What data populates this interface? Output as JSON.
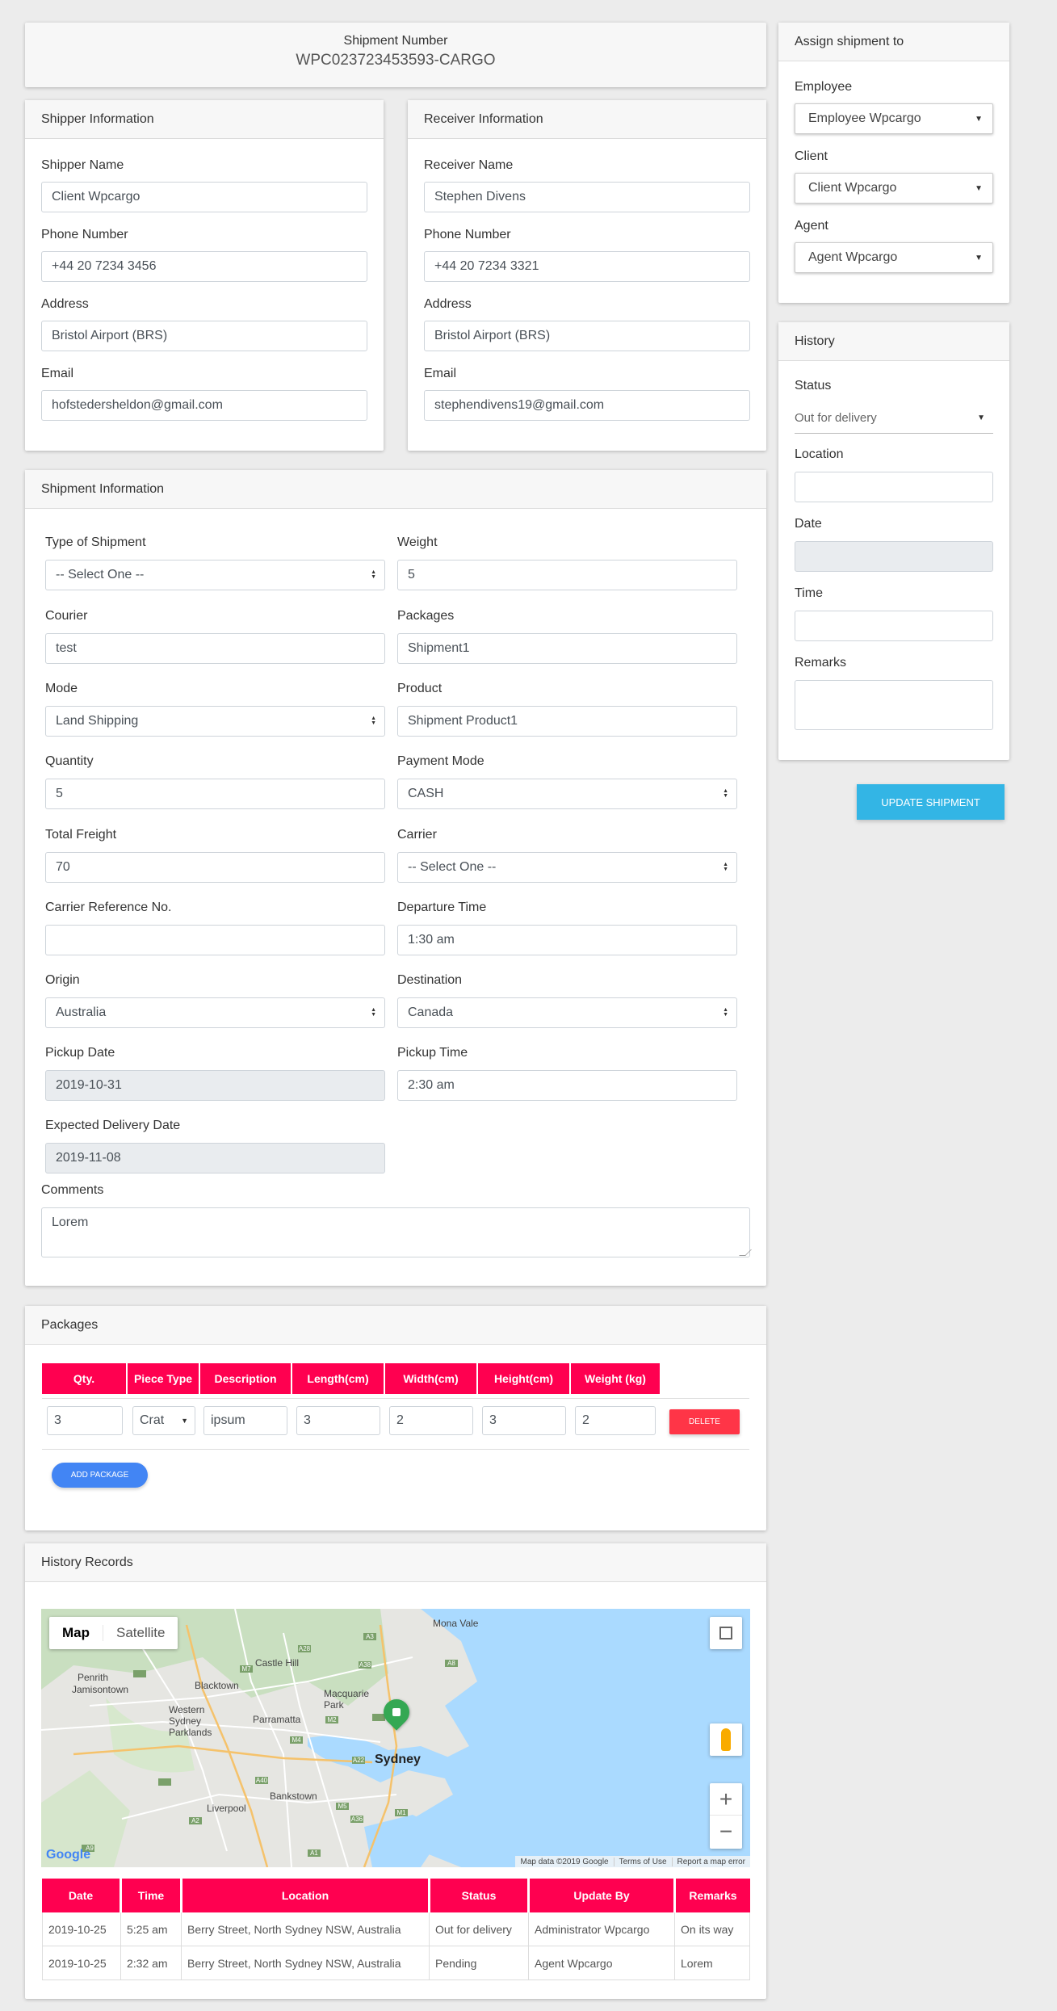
{
  "shipment": {
    "number_label": "Shipment Number",
    "number": "WPC023723453593-CARGO"
  },
  "shipper": {
    "title": "Shipper Information",
    "name_label": "Shipper Name",
    "name": "Client Wpcargo",
    "phone_label": "Phone Number",
    "phone": "+44 20 7234 3456",
    "address_label": "Address",
    "address": "Bristol Airport (BRS)",
    "email_label": "Email",
    "email": "hofstedersheldon@gmail.com"
  },
  "receiver": {
    "title": "Receiver Information",
    "name_label": "Receiver Name",
    "name": "Stephen Divens",
    "phone_label": "Phone Number",
    "phone": "+44 20 7234 3321",
    "address_label": "Address",
    "address": "Bristol Airport (BRS)",
    "email_label": "Email",
    "email": "stephendivens19@gmail.com"
  },
  "assign": {
    "title": "Assign shipment to",
    "employee_label": "Employee",
    "employee": "Employee Wpcargo",
    "client_label": "Client",
    "client": "Client Wpcargo",
    "agent_label": "Agent",
    "agent": "Agent Wpcargo"
  },
  "history": {
    "title": "History",
    "status_label": "Status",
    "status": "Out for delivery",
    "location_label": "Location",
    "date_label": "Date",
    "time_label": "Time",
    "remarks_label": "Remarks",
    "update_button": "UPDATE SHIPMENT"
  },
  "info": {
    "title": "Shipment Information",
    "type_label": "Type of Shipment",
    "type": "-- Select One --",
    "weight_label": "Weight",
    "weight": "5",
    "courier_label": "Courier",
    "courier": "test",
    "packages_label": "Packages",
    "packages": "Shipment1",
    "mode_label": "Mode",
    "mode": "Land Shipping",
    "product_label": "Product",
    "product": "Shipment Product1",
    "quantity_label": "Quantity",
    "quantity": "5",
    "payment_label": "Payment Mode",
    "payment": "CASH",
    "freight_label": "Total Freight",
    "freight": "70",
    "carrier_label": "Carrier",
    "carrier": "-- Select One --",
    "carrier_ref_label": "Carrier Reference No.",
    "carrier_ref": "",
    "departure_label": "Departure Time",
    "departure": "1:30 am",
    "origin_label": "Origin",
    "origin": "Australia",
    "destination_label": "Destination",
    "destination": "Canada",
    "pickup_date_label": "Pickup Date",
    "pickup_date": "2019-10-31",
    "pickup_time_label": "Pickup Time",
    "pickup_time": "2:30 am",
    "expected_label": "Expected Delivery Date",
    "expected": "2019-11-08",
    "comments_label": "Comments",
    "comments": "Lorem"
  },
  "packages": {
    "title": "Packages",
    "headers": [
      "Qty.",
      "Piece Type",
      "Description",
      "Length(cm)",
      "Width(cm)",
      "Height(cm)",
      "Weight (kg)"
    ],
    "row": {
      "qty": "3",
      "piece_type": "Crat",
      "description": "ipsum",
      "length": "3",
      "width": "2",
      "height": "3",
      "weight": "2"
    },
    "delete_button": "DELETE",
    "add_button": "ADD PACKAGE"
  },
  "records": {
    "title": "History Records",
    "map": {
      "tab_map": "Map",
      "tab_satellite": "Satellite",
      "labels": [
        "Mona Vale",
        "Castle Hill",
        "Penrith",
        "Jamisontown",
        "Blacktown",
        "Macquarie Park",
        "Western Sydney Parklands",
        "Parramatta",
        "Sydney",
        "Bankstown",
        "Liverpool"
      ],
      "roads": [
        "A9",
        "M7",
        "A28",
        "A3",
        "A38",
        "A8",
        "M2",
        "M4",
        "A40",
        "A22",
        "M5",
        "A36",
        "M1",
        "A1",
        "A2"
      ],
      "google": "Google",
      "footer": [
        "Map data ©2019 Google",
        "Terms of Use",
        "Report a map error"
      ]
    },
    "headers": [
      "Date",
      "Time",
      "Location",
      "Status",
      "Update By",
      "Remarks"
    ],
    "rows": [
      [
        "2019-10-25",
        "5:25 am",
        "Berry Street, North Sydney NSW, Australia",
        "Out for delivery",
        "Administrator Wpcargo",
        "On its way"
      ],
      [
        "2019-10-25",
        "2:32 am",
        "Berry Street, North Sydney NSW, Australia",
        "Pending",
        "Agent Wpcargo",
        "Lorem"
      ]
    ]
  },
  "colors": {
    "accent": "#ff0050",
    "update": "#33b5e5",
    "add": "#4285f4",
    "delete": "#ff3547",
    "map_water": "#aadaff",
    "map_land": "#e8e8e6",
    "marker": "#34a853"
  }
}
